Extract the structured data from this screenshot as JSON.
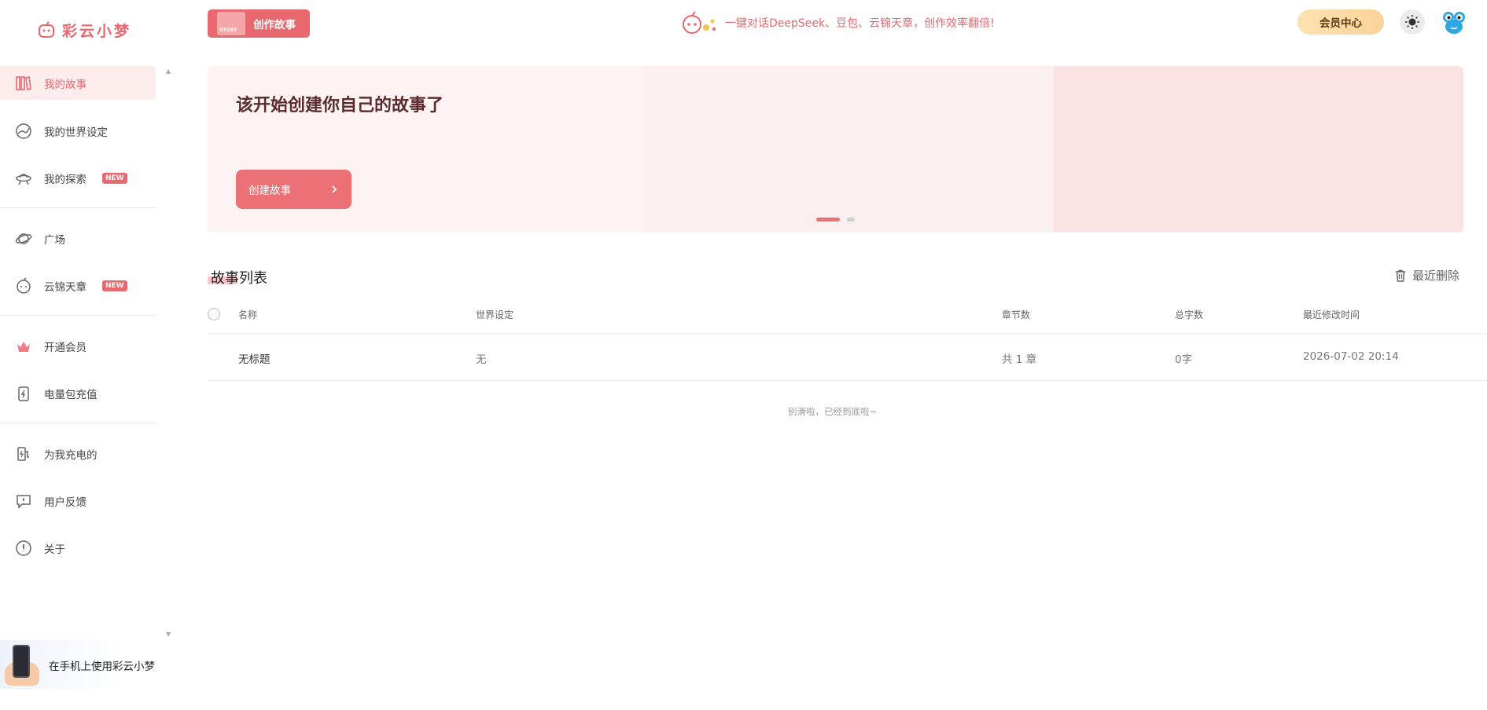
{
  "app": {
    "logo_text": "彩云小梦"
  },
  "sidebar": {
    "items": [
      {
        "label": "我的故事",
        "badge": ""
      },
      {
        "label": "我的世界设定",
        "badge": ""
      },
      {
        "label": "我的探索",
        "badge": "NEW"
      },
      {
        "label": "广场",
        "badge": ""
      },
      {
        "label": "云锦天章",
        "badge": "NEW"
      },
      {
        "label": "开通会员",
        "badge": ""
      },
      {
        "label": "电量包充值",
        "badge": ""
      },
      {
        "label": "为我充电的",
        "badge": ""
      },
      {
        "label": "用户反馈",
        "badge": ""
      },
      {
        "label": "关于",
        "badge": ""
      }
    ],
    "mobile_promo": "在手机上使用彩云小梦"
  },
  "topbar": {
    "create_label": "创作故事",
    "story_icon_text": "STORY",
    "promo_text": "一键对话DeepSeek、豆包、云锦天章，创作效率翻倍!",
    "vip_label": "会员中心"
  },
  "hero": {
    "title": "该开始创建你自己的故事了",
    "button_label": "创建故事"
  },
  "list": {
    "title": "故事列表",
    "recent_delete": "最近删除",
    "columns": [
      "名称",
      "世界设定",
      "章节数",
      "总字数",
      "最近修改时间"
    ],
    "rows": [
      {
        "name": "无标题",
        "world": "无",
        "chapters": "共 1 章",
        "words": "0字",
        "modified": "2026-07-02 20:14"
      }
    ],
    "end_text": "别滑啦，已经到底啦~"
  },
  "colors": {
    "accent": "#e8686f",
    "vip_gradient_start": "#fde2b0",
    "vip_gradient_end": "#fbd39a"
  }
}
